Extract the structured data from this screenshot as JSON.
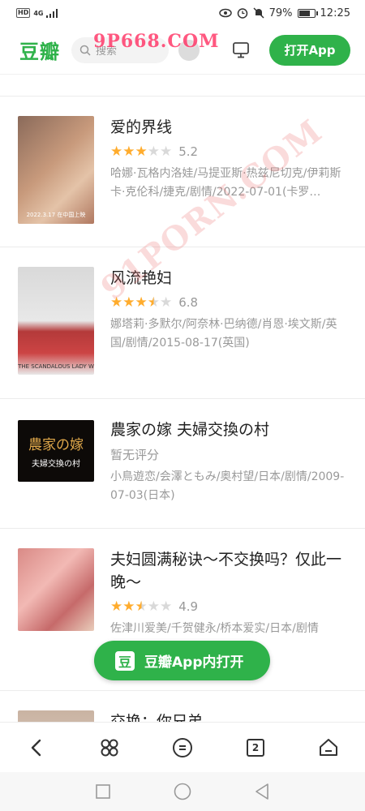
{
  "status_bar": {
    "hd": "HD",
    "network": "4G",
    "battery_pct": "79%",
    "battery_level": 0.79,
    "time": "12:25"
  },
  "header": {
    "logo": "豆瓣",
    "search_placeholder": "搜索",
    "open_app_label": "打开App"
  },
  "watermarks": {
    "top": "9P668.COM",
    "diagonal": "91PORN.COM"
  },
  "items": [
    {
      "title": "爱的界线",
      "stars_filled": 3,
      "score": "5.2",
      "meta": "哈娜·瓦格内洛娃/马提亚斯·热兹尼切克/伊莉斯卡·克伦科/捷克/剧情/2022-07-01(卡罗…",
      "poster_text": "2022.3.17 在中国上映"
    },
    {
      "title": "风流艳妇",
      "stars_filled": 3.5,
      "score": "6.8",
      "meta": "娜塔莉·多默尔/阿奈林·巴纳德/肖恩·埃文斯/英国/剧情/2015-08-17(英国)",
      "poster_text": "THE SCANDALOUS LADY W"
    },
    {
      "title": "農家の嫁 夫婦交換の村",
      "no_rating": "暂无评分",
      "meta": "小鳥遊恋/会澤ともみ/奥村望/日本/剧情/2009-07-03(日本)",
      "poster_title": "農家の嫁",
      "poster_sub": "夫婦交換の村"
    },
    {
      "title": "夫妇圆满秘诀～不交换吗？仅此一晚～",
      "stars_filled": 2.5,
      "score": "4.9",
      "meta": "佐津川爱美/千贺健永/桥本爱实/日本/剧情"
    },
    {
      "title": "交换：你兄弟"
    }
  ],
  "float_button": {
    "icon_text": "豆",
    "label": "豆瓣App内打开"
  },
  "browser_bar": {
    "tab_count": "2"
  }
}
